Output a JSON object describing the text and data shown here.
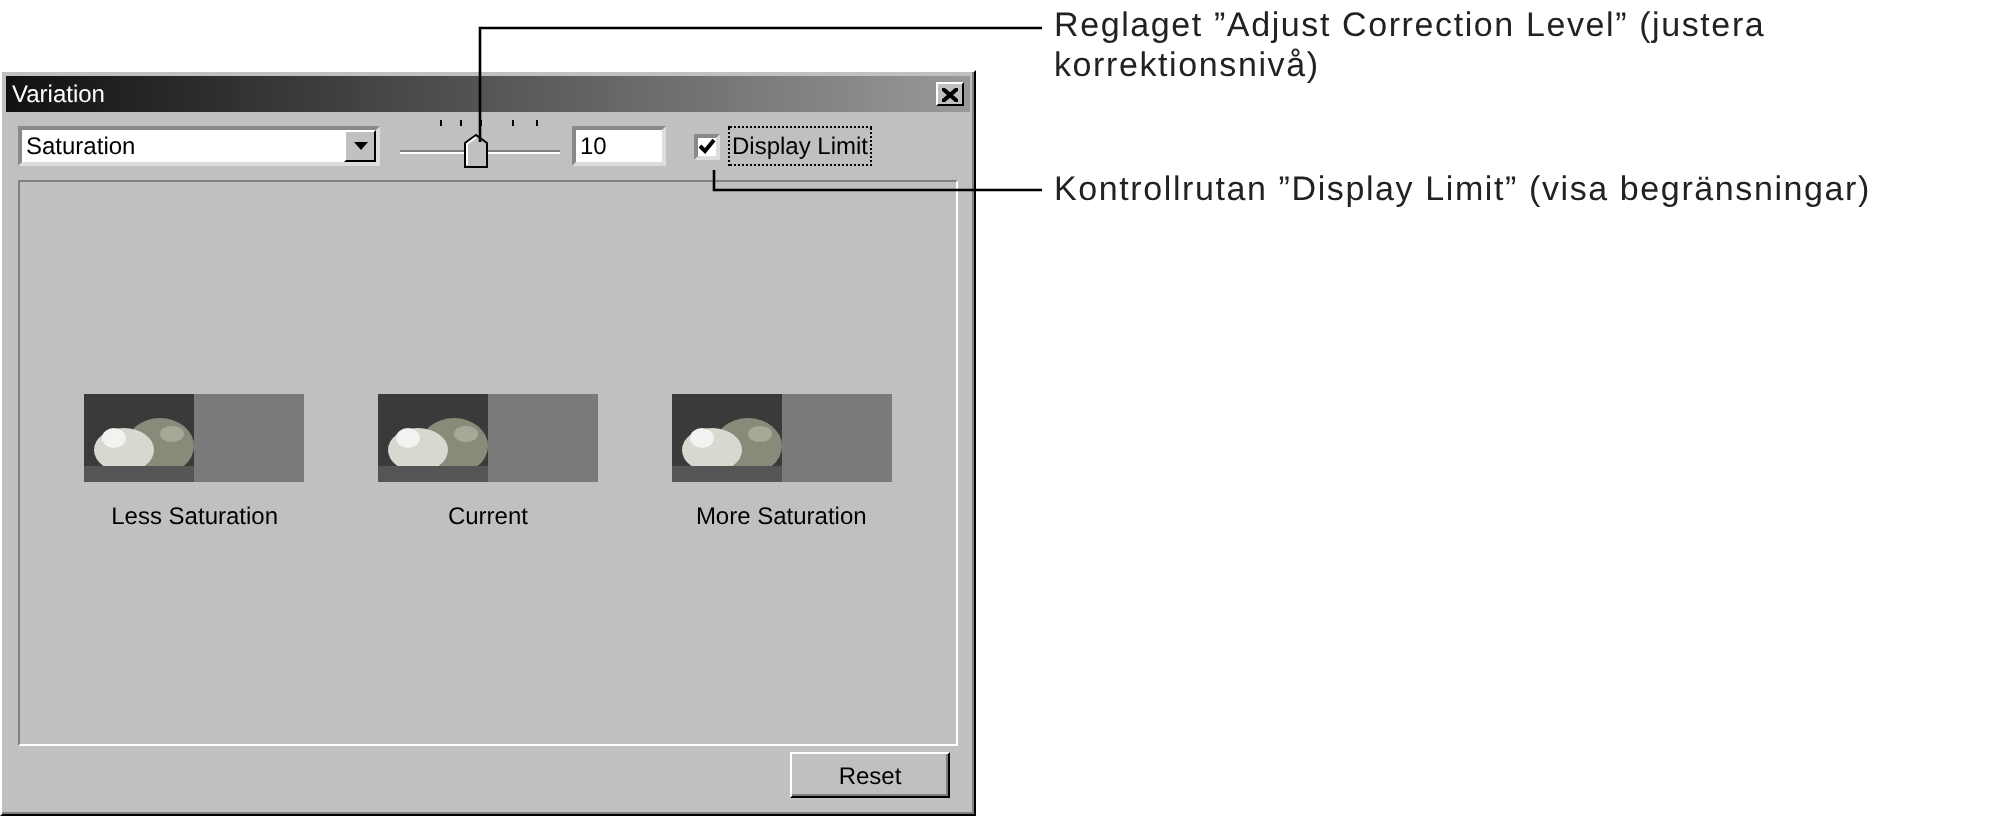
{
  "window": {
    "title": "Variation"
  },
  "toolbar": {
    "mode": "Saturation",
    "slider": {
      "level": 0.48
    },
    "value": "10",
    "display_limit": {
      "label": "Display Limit",
      "checked": true
    }
  },
  "variations": [
    {
      "label": "Less Saturation",
      "kind": "picture"
    },
    {
      "label": "Current",
      "kind": "picture"
    },
    {
      "label": "More Saturation",
      "kind": "picture"
    }
  ],
  "buttons": [
    "Reset"
  ],
  "callouts": [
    {
      "text": "Reglaget ”Adjust Correction Level” (justera korrektionsnivå)"
    },
    {
      "text": "Kontrollrutan ”Display Limit” (visa begränsningar)"
    }
  ]
}
